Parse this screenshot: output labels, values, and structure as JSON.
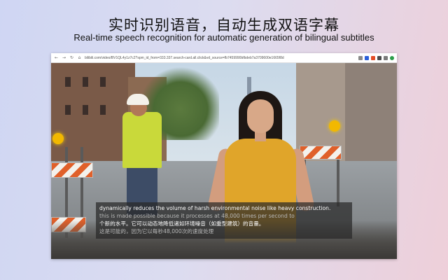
{
  "header": {
    "title": "实时识别语音，自动生成双语字幕",
    "subtitle": "Real-time speech recognition for automatic generation of bilingual subtitles"
  },
  "browser": {
    "back_glyph": "←",
    "forward_glyph": "→",
    "reload_glyph": "↻",
    "home_glyph": "⌂",
    "url": "bilibili.com/video/BV1QL4y1z7c2?spm_id_from=333.337.search-card.all.click&vd_source=fb7459990bfbdeb7a3709600e1665f8d",
    "extension_colors": [
      "#8a8a8a",
      "#2b5fd9",
      "#e34c26",
      "#4a4a4a",
      "#7a7a7a",
      "#2d9d4a"
    ]
  },
  "subtitles": {
    "lines": [
      {
        "text": "dynamically reduces the volume of harsh environmental noise like heavy construction.",
        "state": "active"
      },
      {
        "text": "this is made possible because it processes at 48,000 times per second to",
        "state": "dim"
      },
      {
        "text": "个新的水平。它可以动态地降低诸如环境噪音（如重型建筑）的音量。",
        "state": "active"
      },
      {
        "text": "这是可能的，因为它以每秒48,000次的速度处理",
        "state": "dim"
      }
    ]
  }
}
